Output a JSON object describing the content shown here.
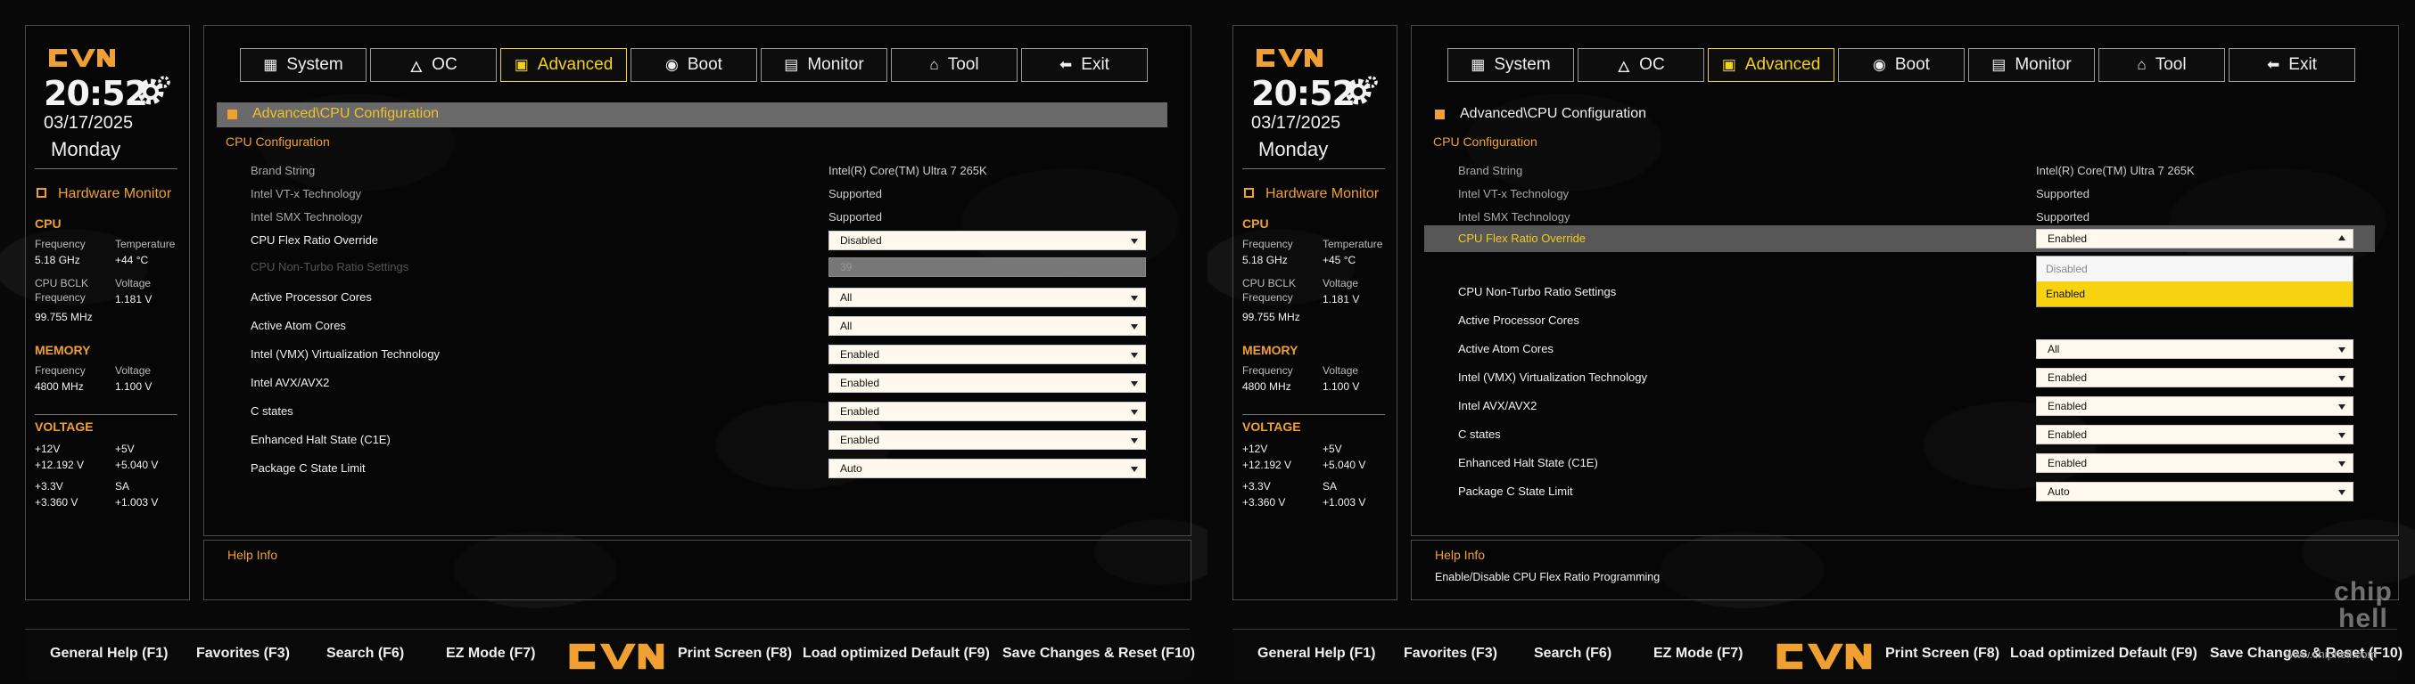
{
  "brand": {
    "accent": "#f0a030",
    "active": "#f3d21a"
  },
  "screens": [
    {
      "clock": "20:52",
      "date": "03/17/2025",
      "day": "Monday",
      "hw": {
        "title": "Hardware Monitor",
        "cpu": {
          "title": "CPU",
          "freq_label": "Frequency",
          "freq": "5.18 GHz",
          "temp_label": "Temperature",
          "temp": "+44 °C",
          "bclk_label1": "CPU BCLK",
          "bclk_label2": "Frequency",
          "bclk": "99.755 MHz",
          "volt_label": "Voltage",
          "volt": "1.181 V"
        },
        "memory": {
          "title": "MEMORY",
          "freq_label": "Frequency",
          "freq": "4800 MHz",
          "volt_label": "Voltage",
          "volt": "1.100 V"
        },
        "voltage": {
          "title": "VOLTAGE",
          "v12_label": "+12V",
          "v12": "+12.192 V",
          "v5_label": "+5V",
          "v5": "+5.040 V",
          "v33_label": "+3.3V",
          "v33": "+3.360 V",
          "sa_label": "SA",
          "sa": "+1.003 V"
        }
      },
      "tabs": [
        "System",
        "OC",
        "Advanced",
        "Boot",
        "Monitor",
        "Tool",
        "Exit"
      ],
      "breadcrumb": "Advanced\\CPU Configuration",
      "category": "CPU Configuration",
      "info": [
        {
          "label": "Brand String",
          "value": "Intel(R) Core(TM) Ultra 7 265K"
        },
        {
          "label": "Intel VT-x Technology",
          "value": "Supported"
        },
        {
          "label": "Intel SMX Technology",
          "value": "Supported"
        }
      ],
      "settings": [
        {
          "label": "CPU Flex Ratio Override",
          "value": "Disabled"
        },
        {
          "label": "CPU Non-Turbo Ratio Settings",
          "value": "39"
        },
        {
          "label": "Active Processor Cores",
          "value": "All"
        },
        {
          "label": "Active Atom Cores",
          "value": "All"
        },
        {
          "label": "Intel (VMX) Virtualization Technology",
          "value": "Enabled"
        },
        {
          "label": "Intel AVX/AVX2",
          "value": "Enabled"
        },
        {
          "label": "C states",
          "value": "Enabled"
        },
        {
          "label": "Enhanced Halt State (C1E)",
          "value": "Enabled"
        },
        {
          "label": "Package C State Limit",
          "value": "Auto"
        }
      ],
      "help": {
        "title": "Help Info",
        "desc": ""
      },
      "bottom": [
        "General Help (F1)",
        "Favorites (F3)",
        "Search (F6)",
        "EZ Mode (F7)",
        "Print Screen (F8)",
        "Load optimized Default (F9)",
        "Save Changes & Reset (F10)"
      ]
    },
    {
      "clock": "20:52",
      "date": "03/17/2025",
      "day": "Monday",
      "hw": {
        "title": "Hardware Monitor",
        "cpu": {
          "title": "CPU",
          "freq_label": "Frequency",
          "freq": "5.18 GHz",
          "temp_label": "Temperature",
          "temp": "+45 °C",
          "bclk_label1": "CPU BCLK",
          "bclk_label2": "Frequency",
          "bclk": "99.755 MHz",
          "volt_label": "Voltage",
          "volt": "1.181 V"
        },
        "memory": {
          "title": "MEMORY",
          "freq_label": "Frequency",
          "freq": "4800 MHz",
          "volt_label": "Voltage",
          "volt": "1.100 V"
        },
        "voltage": {
          "title": "VOLTAGE",
          "v12_label": "+12V",
          "v12": "+12.192 V",
          "v5_label": "+5V",
          "v5": "+5.040 V",
          "v33_label": "+3.3V",
          "v33": "+3.360 V",
          "sa_label": "SA",
          "sa": "+1.003 V"
        }
      },
      "tabs": [
        "System",
        "OC",
        "Advanced",
        "Boot",
        "Monitor",
        "Tool",
        "Exit"
      ],
      "breadcrumb": "Advanced\\CPU Configuration",
      "category": "CPU Configuration",
      "info": [
        {
          "label": "Brand String",
          "value": "Intel(R) Core(TM) Ultra 7 265K"
        },
        {
          "label": "Intel VT-x Technology",
          "value": "Supported"
        },
        {
          "label": "Intel SMX Technology",
          "value": "Supported"
        }
      ],
      "settings": [
        {
          "label": "CPU Flex Ratio Override",
          "value": "Enabled"
        },
        {
          "label": "CPU Non-Turbo Ratio Settings",
          "value": ""
        },
        {
          "label": "Active Processor Cores",
          "value": ""
        },
        {
          "label": "Active Atom Cores",
          "value": "All"
        },
        {
          "label": "Intel (VMX) Virtualization Technology",
          "value": "Enabled"
        },
        {
          "label": "Intel AVX/AVX2",
          "value": "Enabled"
        },
        {
          "label": "C states",
          "value": "Enabled"
        },
        {
          "label": "Enhanced Halt State (C1E)",
          "value": "Enabled"
        },
        {
          "label": "Package C State Limit",
          "value": "Auto"
        }
      ],
      "dropdown": {
        "options": [
          "Disabled",
          "Enabled"
        ]
      },
      "help": {
        "title": "Help Info",
        "desc": "Enable/Disable CPU Flex Ratio Programming"
      },
      "bottom": [
        "General Help (F1)",
        "Favorites (F3)",
        "Search (F6)",
        "EZ Mode (F7)",
        "Print Screen (F8)",
        "Load optimized Default (F9)",
        "Save Changes & Reset (F10)"
      ]
    }
  ],
  "watermark": {
    "url": "www.chiphell.com",
    "logo_line1": "chip",
    "logo_line2": "hell"
  }
}
